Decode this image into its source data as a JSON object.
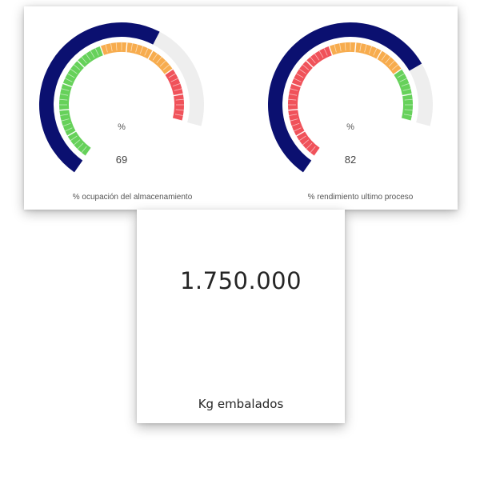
{
  "colors": {
    "value_arc": "#0b1070",
    "track": "#eeeeee",
    "green": "#66d15a",
    "orange": "#f7ac4e",
    "red": "#f0525a"
  },
  "gauges": [
    {
      "unit": "%",
      "value": 69,
      "value_text": "69",
      "label": "% ocupación del almacenamiento",
      "bands": [
        {
          "from": 0,
          "to": 50,
          "color": "#66d15a"
        },
        {
          "from": 50,
          "to": 80,
          "color": "#f7ac4e"
        },
        {
          "from": 80,
          "to": 100,
          "color": "#f0525a"
        }
      ]
    },
    {
      "unit": "%",
      "value": 82,
      "value_text": "82",
      "label": "% rendimiento ultimo proceso",
      "bands": [
        {
          "from": 0,
          "to": 50,
          "color": "#f0525a"
        },
        {
          "from": 50,
          "to": 80,
          "color": "#f7ac4e"
        },
        {
          "from": 80,
          "to": 100,
          "color": "#66d15a"
        }
      ]
    }
  ],
  "kpi": {
    "value": "1.750.000",
    "label": "Kg embalados"
  }
}
